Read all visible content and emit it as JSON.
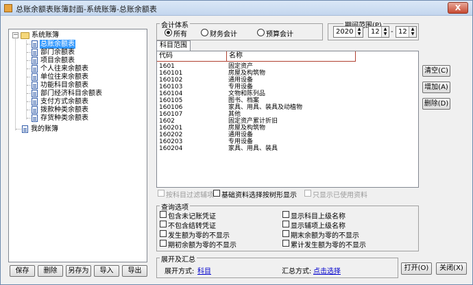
{
  "window": {
    "title": "总账余额表账簿封面-系统账簿-总账余额表",
    "close_label": "X"
  },
  "tree": {
    "root_label": "系统账簿",
    "items": [
      {
        "label": "总账余额表",
        "selected": true
      },
      {
        "label": "部门余额表"
      },
      {
        "label": "项目余额表"
      },
      {
        "label": "个人往来余额表"
      },
      {
        "label": "单位往来余额表"
      },
      {
        "label": "功能科目余额表"
      },
      {
        "label": "部门经济科目余额表"
      },
      {
        "label": "支付方式余额表"
      },
      {
        "label": "拨款种类余额表"
      },
      {
        "label": "存货种类余额表"
      }
    ],
    "second_root_label": "我的账簿",
    "expand_symbol": "−"
  },
  "bottom_left_buttons": {
    "save": "保存",
    "delete": "删除",
    "save_as": "另存为",
    "import": "导入",
    "export": "导出"
  },
  "accounting_system": {
    "title": "会计体系",
    "options": [
      "所有",
      "财务会计",
      "预算会计"
    ],
    "selected": "所有"
  },
  "period": {
    "title": "期间范围(P)",
    "year": "2020",
    "month_from": "12",
    "separator": "-",
    "month_to": "12"
  },
  "subject_tab": "科目范围",
  "subject_list": {
    "columns": [
      "代码",
      "名称"
    ],
    "rows": [
      {
        "code": "1601",
        "name": "固定资产"
      },
      {
        "code": "160101",
        "name": "房屋及构筑物"
      },
      {
        "code": "160102",
        "name": "通用设备"
      },
      {
        "code": "160103",
        "name": "专用设备"
      },
      {
        "code": "160104",
        "name": "文物和陈列品"
      },
      {
        "code": "160105",
        "name": "图书、档案"
      },
      {
        "code": "160106",
        "name": "家具、用具、装具及动植物"
      },
      {
        "code": "160107",
        "name": "其他"
      },
      {
        "code": "1602",
        "name": "固定资产累计折旧"
      },
      {
        "code": "160201",
        "name": "房屋及构筑物"
      },
      {
        "code": "160202",
        "name": "通用设备"
      },
      {
        "code": "160203",
        "name": "专用设备"
      },
      {
        "code": "160204",
        "name": "家具、用具、装具"
      }
    ]
  },
  "right_buttons": {
    "clear": "清空(C)",
    "add": "增加(A)",
    "delete": "删除(D)"
  },
  "filter_row": {
    "by_subject_filter": "按科目过滤辅项",
    "tree_display": "基础资料选择按树形显示",
    "only_used": "只显示已使用资料"
  },
  "query_options": {
    "title": "查询选项",
    "left": [
      "包含未记账凭证",
      "不包含结转凭证",
      "发生额为零的不显示",
      "期初余额为零的不显示"
    ],
    "right": [
      "显示科目上级名称",
      "显示辅项上级名称",
      "期末余额为零的不显示",
      "累计发生额为零的不显示"
    ]
  },
  "expand_summary": {
    "title": "展开及汇总",
    "expand_label": "展开方式:",
    "expand_value": "科目",
    "summary_label": "汇总方式:",
    "summary_value": "点击选择"
  },
  "footer_buttons": {
    "open": "打开(O)",
    "close": "关闭(X)"
  }
}
